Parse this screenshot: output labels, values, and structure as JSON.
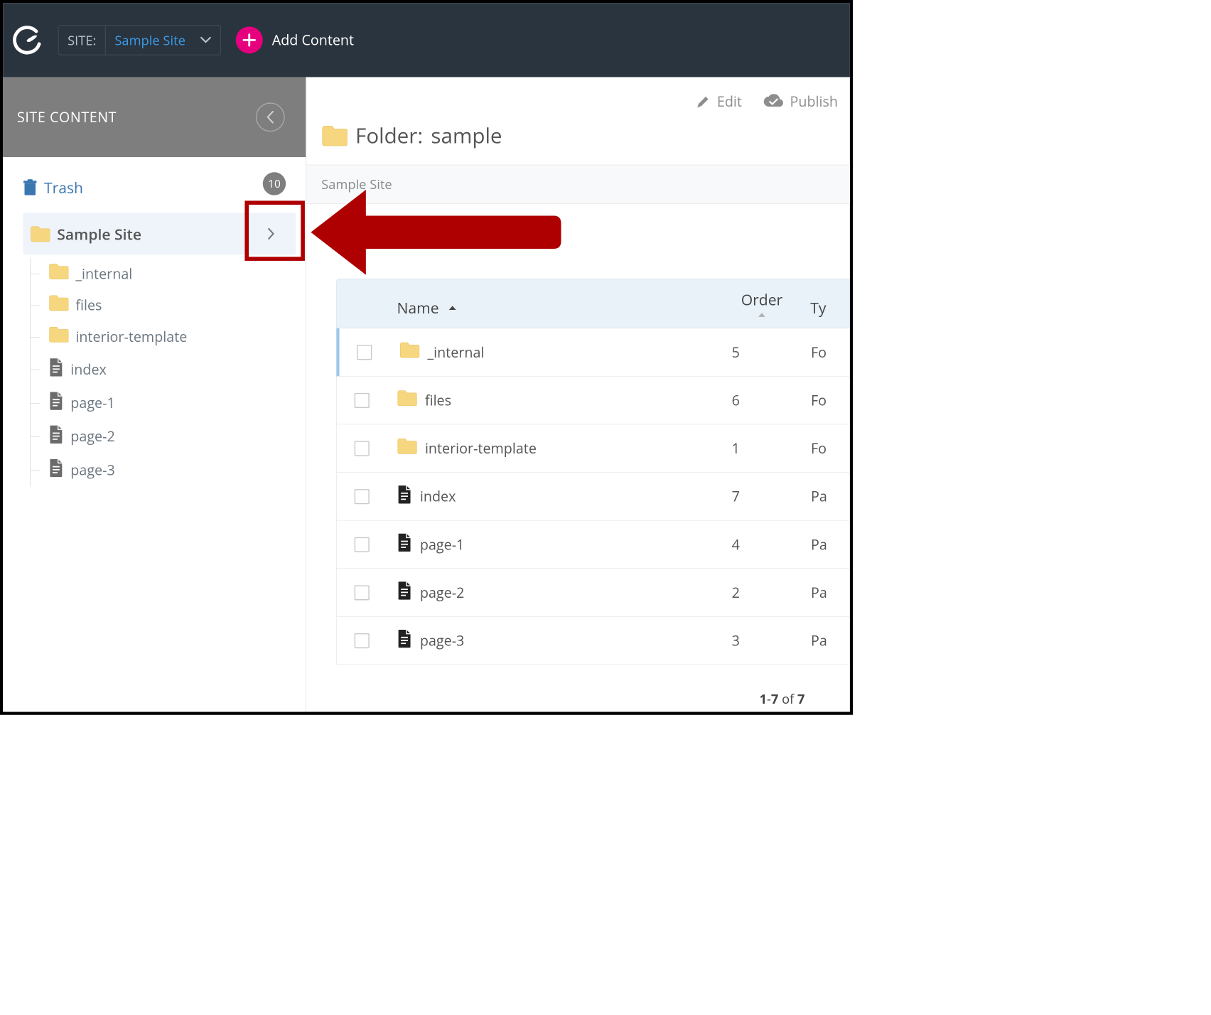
{
  "topbar": {
    "site_label": "SITE:",
    "site_value": "Sample Site",
    "add_content_label": "Add Content"
  },
  "sidebar": {
    "title": "SITE CONTENT",
    "trash_label": "Trash",
    "badge_count": "10",
    "root_label": "Sample Site",
    "items": [
      {
        "label": "_internal",
        "type": "folder"
      },
      {
        "label": "files",
        "type": "folder"
      },
      {
        "label": "interior-template",
        "type": "folder"
      },
      {
        "label": "index",
        "type": "page"
      },
      {
        "label": "page-1",
        "type": "page"
      },
      {
        "label": "page-2",
        "type": "page"
      },
      {
        "label": "page-3",
        "type": "page"
      }
    ]
  },
  "actions": {
    "edit": "Edit",
    "publish": "Publish"
  },
  "content": {
    "folder_prefix": "Folder: ",
    "folder_name": "sample",
    "breadcrumb": "Sample Site"
  },
  "table": {
    "columns": {
      "name": "Name",
      "order": "Order",
      "type": "Ty"
    },
    "rows": [
      {
        "name": "_internal",
        "order": "5",
        "type": "Fo",
        "icon": "folder"
      },
      {
        "name": "files",
        "order": "6",
        "type": "Fo",
        "icon": "folder"
      },
      {
        "name": "interior-template",
        "order": "1",
        "type": "Fo",
        "icon": "folder"
      },
      {
        "name": "index",
        "order": "7",
        "type": "Pa",
        "icon": "page"
      },
      {
        "name": "page-1",
        "order": "4",
        "type": "Pa",
        "icon": "page"
      },
      {
        "name": "page-2",
        "order": "2",
        "type": "Pa",
        "icon": "page"
      },
      {
        "name": "page-3",
        "order": "3",
        "type": "Pa",
        "icon": "page"
      }
    ],
    "pagination": {
      "from": "1",
      "to": "7",
      "of_label": "of",
      "total": "7"
    }
  },
  "icons": {
    "folder_fill": "#f6d77f",
    "folder_stroke": "#e9c560",
    "page_fill": "#5d5d5d"
  }
}
